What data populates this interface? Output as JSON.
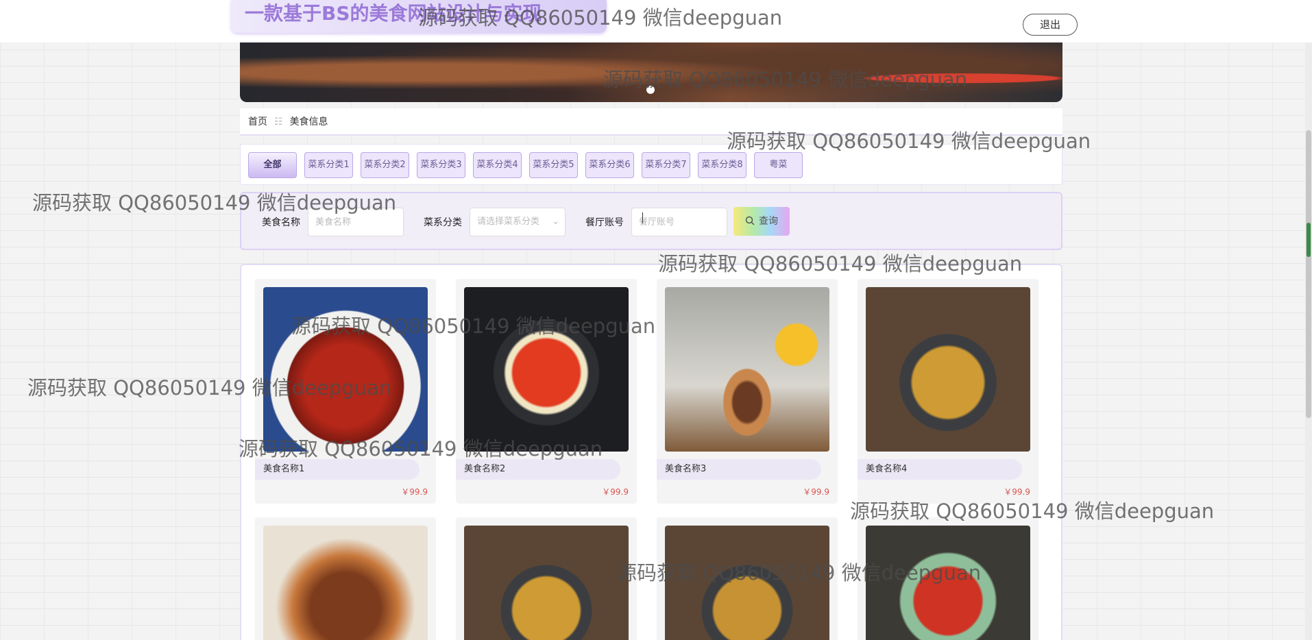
{
  "header": {
    "site_title": "一款基于BS的美食网站设计与实现",
    "logout_label": "退出"
  },
  "breadcrumb": {
    "home": "首页",
    "separator": "☷",
    "current": "美食信息"
  },
  "categories": [
    "全部",
    "菜系分类1",
    "菜系分类2",
    "菜系分类3",
    "菜系分类4",
    "菜系分类5",
    "菜系分类6",
    "菜系分类7",
    "菜系分类8",
    "粤菜"
  ],
  "active_category": "全部",
  "search": {
    "name_label": "美食名称",
    "name_placeholder": "美食名称",
    "category_label": "菜系分类",
    "category_placeholder": "请选择菜系分类",
    "account_label": "餐厅账号",
    "account_placeholder": "餐厅账号",
    "button_label": "查询"
  },
  "foods": [
    {
      "name": "美食名称1",
      "price": "￥99.9"
    },
    {
      "name": "美食名称2",
      "price": "￥99.9"
    },
    {
      "name": "美食名称3",
      "price": "￥99.9"
    },
    {
      "name": "美食名称4",
      "price": "￥99.9"
    }
  ],
  "watermark": "源码获取 QQ86050149 微信deepguan",
  "colors": {
    "accent": "#b9a6e8",
    "title": "#9b7ad9",
    "price": "#d9534f"
  },
  "icons": {
    "search": "search-icon",
    "dropdown": "chevron-down-icon"
  }
}
